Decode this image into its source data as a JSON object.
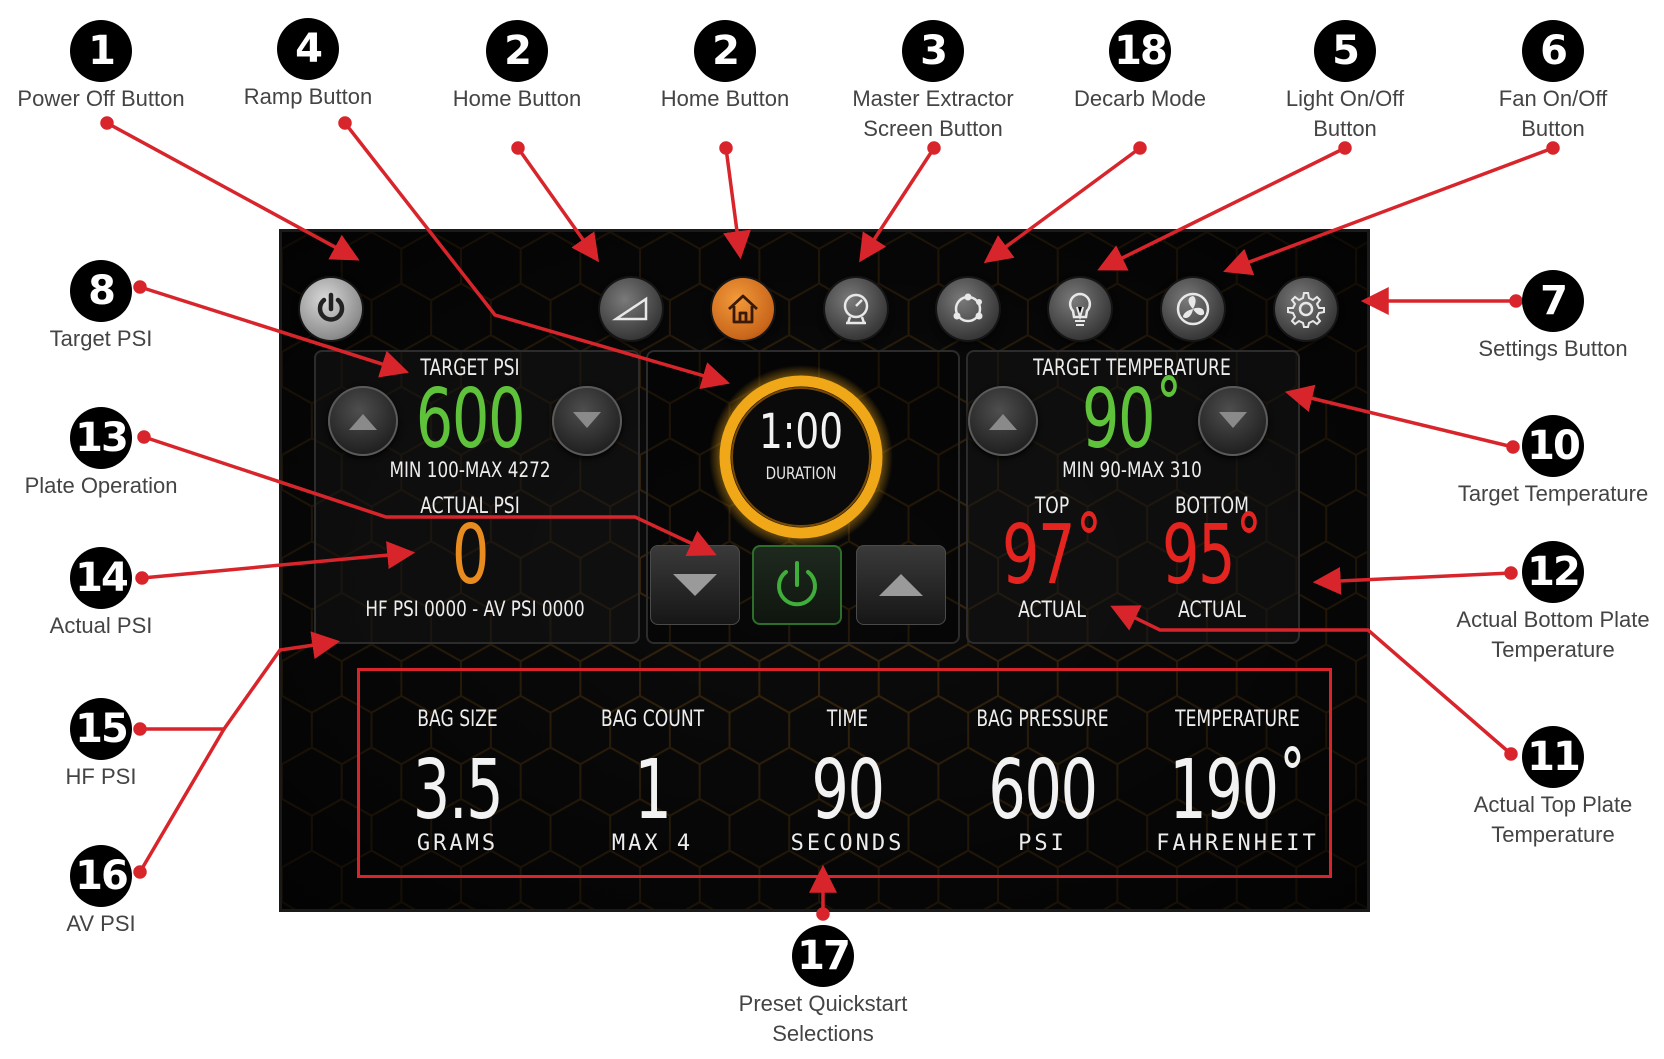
{
  "annotations": [
    {
      "number": "1",
      "label": "Power Off Button"
    },
    {
      "number": "4",
      "label": "Ramp Button"
    },
    {
      "number": "2",
      "label": "Home Button"
    },
    {
      "number": "2",
      "label": "Home Button"
    },
    {
      "number": "3",
      "label": "Master Extractor\nScreen Button"
    },
    {
      "number": "18",
      "label": "Decarb Mode"
    },
    {
      "number": "5",
      "label": "Light On/Off\nButton"
    },
    {
      "number": "6",
      "label": "Fan On/Off\nButton"
    },
    {
      "number": "8",
      "label": "Target PSI"
    },
    {
      "number": "7",
      "label": "Settings Button"
    },
    {
      "number": "13",
      "label": "Plate Operation"
    },
    {
      "number": "10",
      "label": "Target Temperature"
    },
    {
      "number": "14",
      "label": "Actual PSI"
    },
    {
      "number": "12",
      "label": "Actual Bottom Plate\nTemperature"
    },
    {
      "number": "15",
      "label": "HF PSI"
    },
    {
      "number": "11",
      "label": "Actual Top Plate\nTemperature"
    },
    {
      "number": "16",
      "label": "AV PSI"
    },
    {
      "number": "17",
      "label": "Preset Quickstart\nSelections"
    }
  ],
  "toolbar": {
    "icons": [
      "power-icon",
      "ramp-icon",
      "home-icon",
      "gauge-icon",
      "decarb-molecule-icon",
      "lightbulb-icon",
      "fan-icon",
      "gear-icon"
    ],
    "active": "home-icon"
  },
  "psi": {
    "target_label": "TARGET PSI",
    "target_value": "600",
    "range": "MIN 100-MAX 4272",
    "actual_label": "ACTUAL  PSI",
    "actual_value": "0",
    "sensor_line": "HF PSI 0000 - AV PSI 0000"
  },
  "timer": {
    "value": "1:00",
    "label": "DURATION"
  },
  "temperature": {
    "target_label": "TARGET TEMPERATURE",
    "target_value": "90˚",
    "range": "MIN 90-MAX 310",
    "top_label": "TOP",
    "top_value": "97˚",
    "top_caption": "ACTUAL",
    "bottom_label": "BOTTOM",
    "bottom_value": "95˚",
    "bottom_caption": "ACTUAL"
  },
  "presets": [
    {
      "header": "BAG SIZE",
      "value": "3.5",
      "unit": "GRAMS"
    },
    {
      "header": "BAG COUNT",
      "value": "1",
      "unit": "MAX 4"
    },
    {
      "header": "TIME",
      "value": "90",
      "unit": "SECONDS"
    },
    {
      "header": "BAG PRESSURE",
      "value": "600",
      "unit": "PSI"
    },
    {
      "header": "TEMPERATURE",
      "value": "190˚",
      "unit": "FAHRENHEIT"
    }
  ],
  "colors": {
    "target_green": "#5fc23b",
    "actual_orange": "#e98c1f",
    "actual_red": "#e52420",
    "ring_gold": "#f0a818",
    "power_green": "#3fae3a",
    "annotation_red": "#d8252b",
    "active_orange": "#e07a2a"
  }
}
